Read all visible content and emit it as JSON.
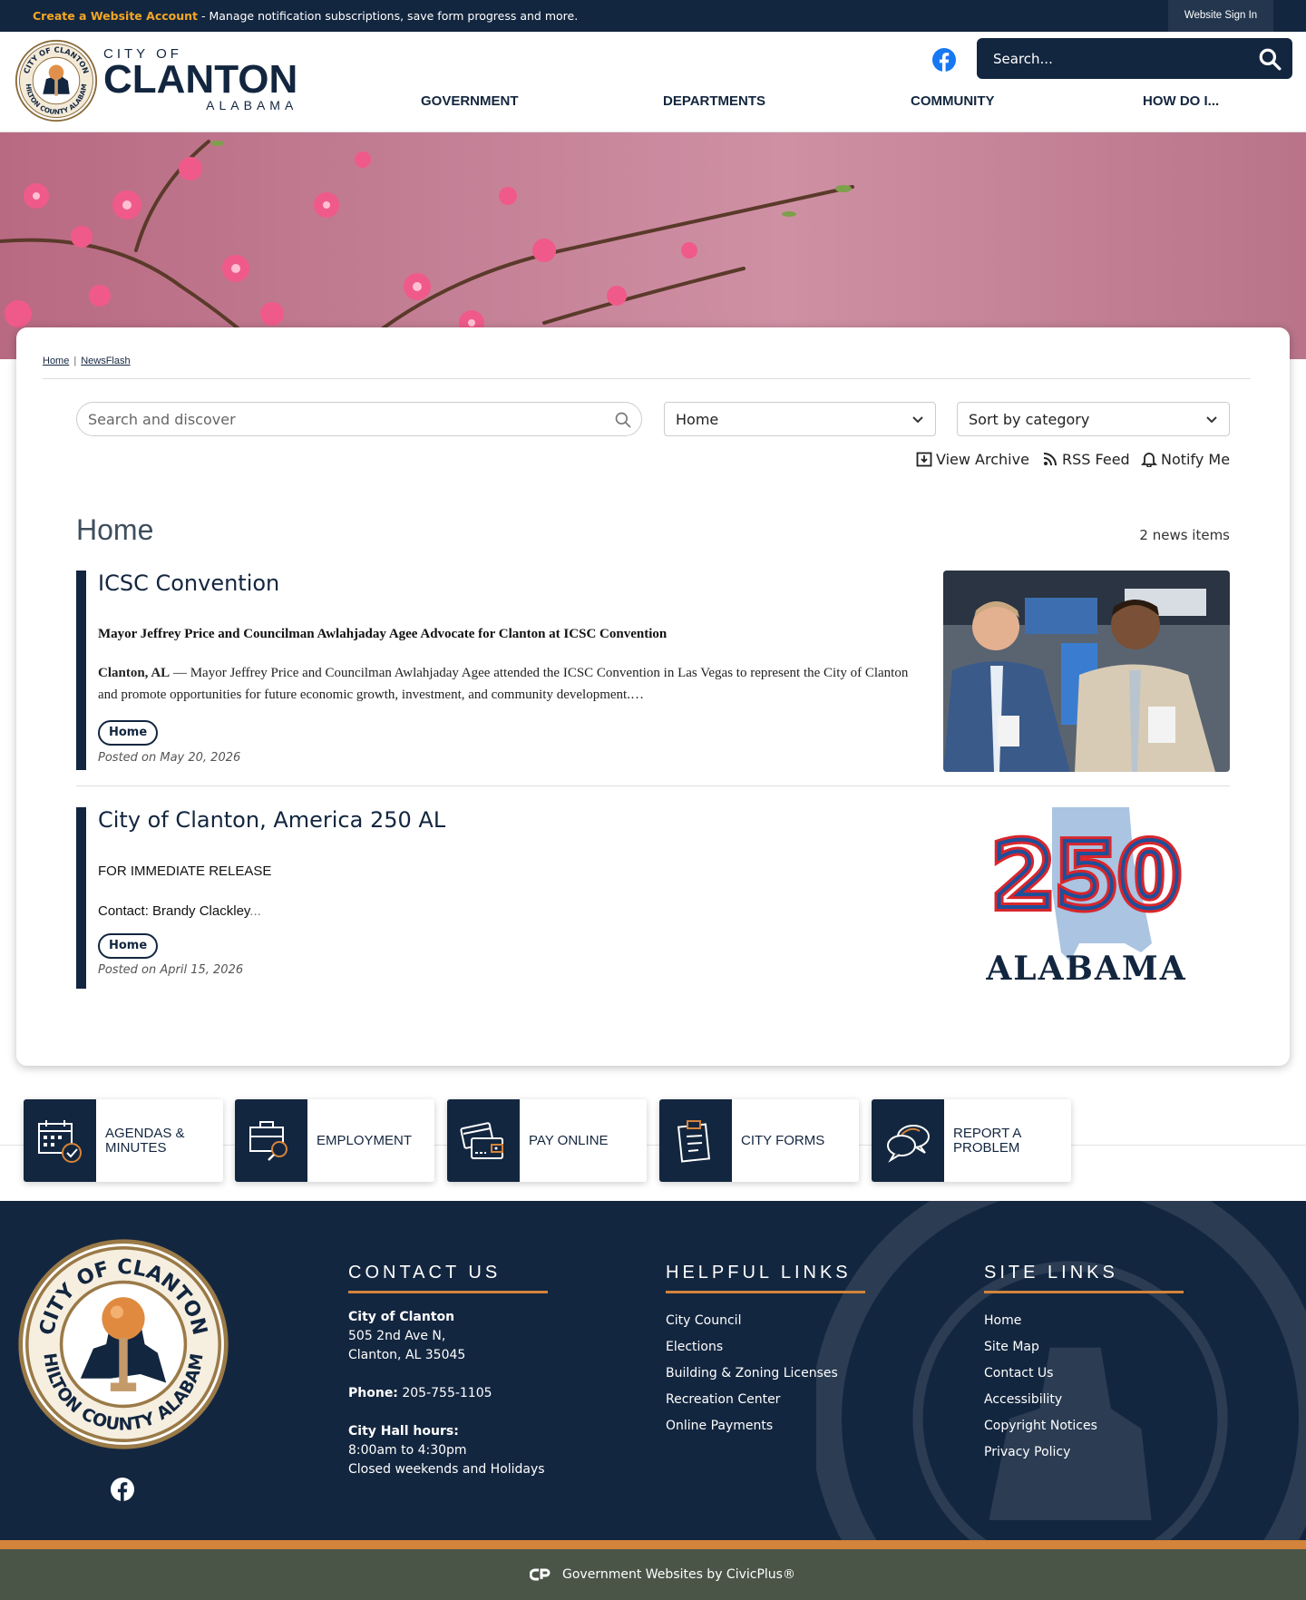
{
  "topbar": {
    "create_link": "Create a Website Account",
    "message": " - Manage notification subscriptions, save form progress and more.",
    "sign_in": "Website Sign In"
  },
  "header": {
    "city_of": "CITY OF",
    "clanton": "CLANTON",
    "alabama": "ALABAMA",
    "search_placeholder": "Search...",
    "nav": [
      "GOVERNMENT",
      "DEPARTMENTS",
      "COMMUNITY",
      "HOW DO I..."
    ]
  },
  "breadcrumb": {
    "home": "Home",
    "separator": "|",
    "current": "NewsFlash"
  },
  "filters": {
    "search_placeholder": "Search and discover",
    "category_value": "Home",
    "sort_value": "Sort by category"
  },
  "tools": {
    "archive": "View Archive",
    "rss": "RSS Feed",
    "notify": "Notify Me"
  },
  "section": {
    "title": "Home",
    "count": "2 news items"
  },
  "news": [
    {
      "title": "ICSC Convention",
      "headline": "Mayor Jeffrey Price and Councilman Awlahjaday Agee Advocate for Clanton at ICSC Convention",
      "dateline": "Clanton, AL",
      "body": " — Mayor Jeffrey Price and Councilman Awlahjaday Agee attended the ICSC Convention in Las Vegas to represent the City of Clanton and promote opportunities for future economic growth, investment, and community development.…",
      "tag": "Home",
      "posted": "Posted on May 20, 2026"
    },
    {
      "title": "City of Clanton, America 250 AL",
      "line1": "FOR IMMEDIATE RELEASE",
      "line2": "Contact: Brandy Clackley",
      "ellipsis": "...",
      "tag": "Home",
      "posted": "Posted on April 15, 2026",
      "logo_number": "250",
      "logo_text": "ALABAMA"
    }
  ],
  "quick_links": [
    "AGENDAS & MINUTES",
    "EMPLOYMENT",
    "PAY ONLINE",
    "CITY FORMS",
    "REPORT A PROBLEM"
  ],
  "footer": {
    "contact": {
      "heading": "CONTACT US",
      "org": "City of Clanton",
      "address1": "505 2nd Ave N,",
      "address2": "Clanton, AL 35045",
      "phone_label": "Phone:",
      "phone": " 205-755-1105",
      "hours_label": "City Hall hours:",
      "hours1": "8:00am to 4:30pm",
      "hours2": "Closed weekends and Holidays"
    },
    "helpful": {
      "heading": "HELPFUL LINKS",
      "links": [
        "City Council",
        "Elections",
        "Building & Zoning Licenses",
        "Recreation Center",
        "Online Payments"
      ]
    },
    "site": {
      "heading": "SITE LINKS",
      "links": [
        "Home",
        "Site Map",
        "Contact Us",
        "Accessibility",
        "Copyright Notices",
        "Privacy Policy"
      ]
    },
    "credit": "Government Websites by CivicPlus®"
  },
  "seal": {
    "top_text": "CITY OF CLANTON",
    "bottom_text": "CHILTON COUNTY ALABAMA"
  },
  "colors": {
    "navy": "#13263f",
    "orange": "#d4833a",
    "accent_link": "#f5a623",
    "footer_bottom": "#4a5548"
  }
}
